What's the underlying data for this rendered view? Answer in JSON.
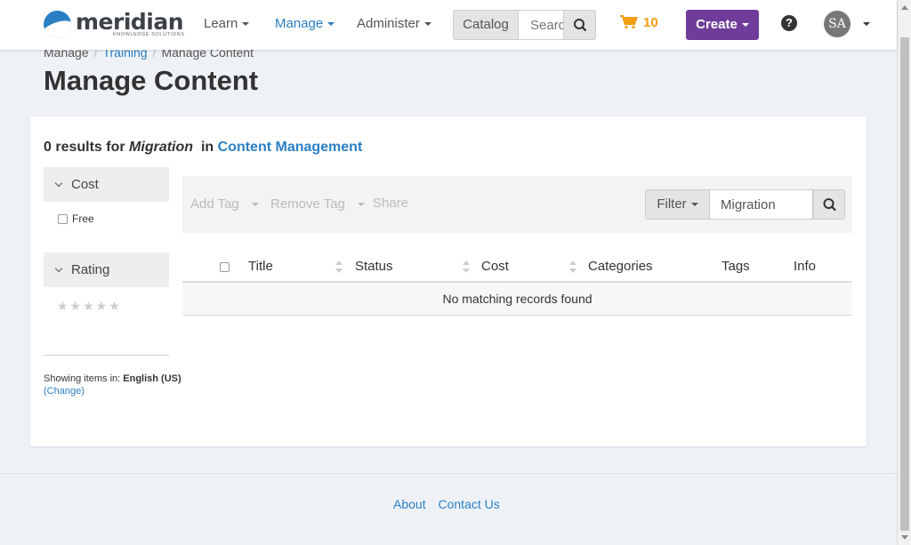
{
  "nav": {
    "logo_text": "meridian",
    "logo_subtitle": "KNOWLEDGE SOLUTIONS",
    "learn": "Learn",
    "manage": "Manage",
    "administer": "Administer",
    "catalog": "Catalog",
    "search_placeholder": "Search",
    "cart_count": "10",
    "create": "Create",
    "help": "?",
    "avatar_initials": "SA"
  },
  "breadcrumb": [
    "Manage",
    "Training",
    "Manage Content"
  ],
  "page_title": "Manage Content",
  "results": {
    "count_prefix": "0 results for",
    "query": "Migration",
    "in_text": "in",
    "scope": "Content Management"
  },
  "facets": {
    "cost_label": "Cost",
    "cost_options": [
      "Free"
    ],
    "rating_label": "Rating",
    "stars": "★★★★★",
    "locale_prefix": "Showing items in:",
    "locale_value": "English (US)",
    "change_label": "(Change)"
  },
  "toolbar": {
    "add_tag": "Add Tag",
    "remove_tag": "Remove Tag",
    "share": "Share",
    "filter": "Filter",
    "filter_value": "Migration"
  },
  "table": {
    "columns": [
      "Title",
      "Status",
      "Cost",
      "Categories",
      "Tags",
      "Info"
    ],
    "empty_message": "No matching records found"
  },
  "footer": {
    "about": "About",
    "contact": "Contact Us"
  },
  "colors": {
    "accent": "#2a7fc4",
    "create": "#6f3d99",
    "cart": "#f39c12"
  }
}
